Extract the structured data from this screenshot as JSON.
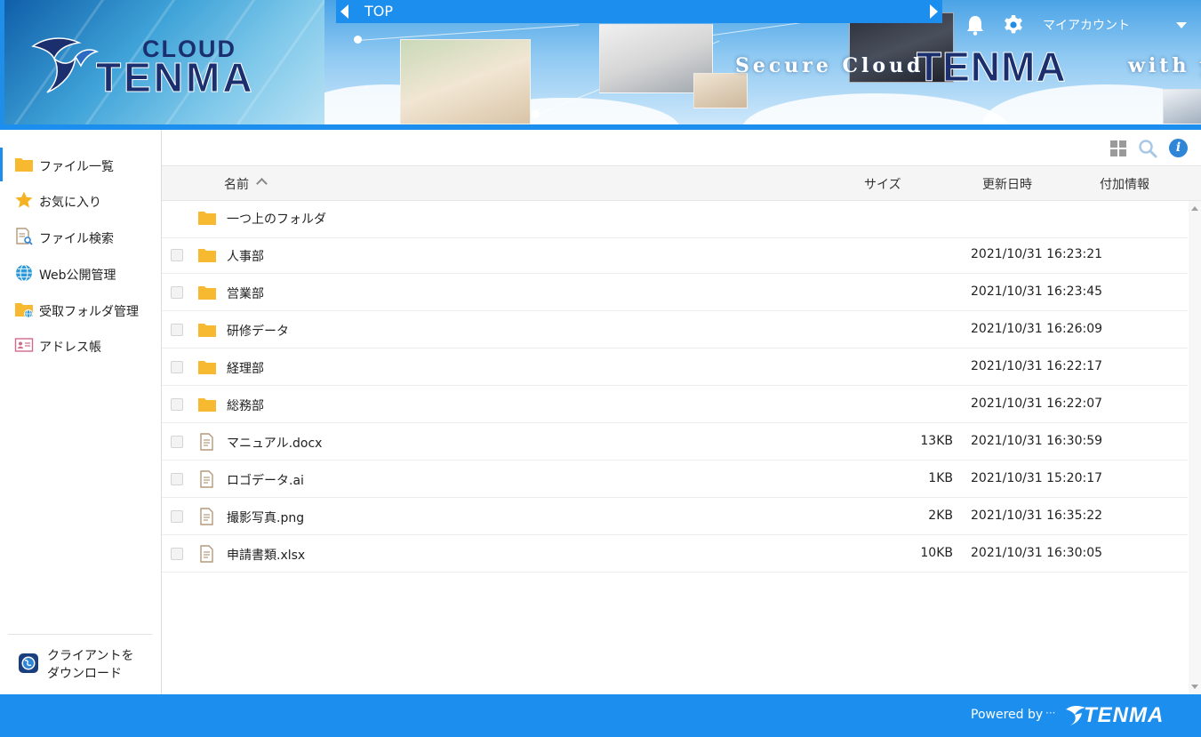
{
  "header": {
    "logo": {
      "cloud_text": "CLOUD",
      "tenma_text": "TENMA"
    },
    "banner": {
      "secure_text": "Secure Cloud",
      "tenma_text": "TENMA",
      "with_text": "with y"
    },
    "breadcrumb": {
      "current": "TOP"
    },
    "account_label": "マイアカウント",
    "icons": {
      "notification": "bell-icon",
      "settings": "gear-icon",
      "account_menu": "chevron-down-icon"
    }
  },
  "sidebar": {
    "items": [
      {
        "label": "ファイル一覧",
        "icon": "folder-icon",
        "active": true
      },
      {
        "label": "お気に入り",
        "icon": "star-icon",
        "active": false
      },
      {
        "label": "ファイル検索",
        "icon": "file-search-icon",
        "active": false
      },
      {
        "label": "Web公開管理",
        "icon": "globe-icon",
        "active": false
      },
      {
        "label": "受取フォルダ管理",
        "icon": "folder-globe-icon",
        "active": false
      },
      {
        "label": "アドレス帳",
        "icon": "address-card-icon",
        "active": false
      }
    ],
    "client_download": {
      "label_line1": "クライアントを",
      "label_line2": "ダウンロード",
      "icon": "globe-badge-icon"
    }
  },
  "toolbar": {
    "icons": [
      "grid-view-icon",
      "search-icon",
      "info-icon"
    ],
    "info_glyph": "i"
  },
  "table": {
    "columns": {
      "name": "名前",
      "size": "サイズ",
      "date": "更新日時",
      "extra": "付加情報"
    },
    "sort": {
      "column": "name",
      "direction": "asc"
    },
    "parent_folder_label": "一つ上のフォルダ",
    "rows": [
      {
        "type": "folder",
        "name": "人事部",
        "size": "",
        "date": "2021/10/31 16:23:21"
      },
      {
        "type": "folder",
        "name": "営業部",
        "size": "",
        "date": "2021/10/31 16:23:45"
      },
      {
        "type": "folder",
        "name": "研修データ",
        "size": "",
        "date": "2021/10/31 16:26:09"
      },
      {
        "type": "folder",
        "name": "経理部",
        "size": "",
        "date": "2021/10/31 16:22:17"
      },
      {
        "type": "folder",
        "name": "総務部",
        "size": "",
        "date": "2021/10/31 16:22:07"
      },
      {
        "type": "file",
        "name": "マニュアル.docx",
        "size": "13KB",
        "date": "2021/10/31 16:30:59"
      },
      {
        "type": "file",
        "name": "ロゴデータ.ai",
        "size": "1KB",
        "date": "2021/10/31 15:20:17"
      },
      {
        "type": "file",
        "name": "撮影写真.png",
        "size": "2KB",
        "date": "2021/10/31 16:35:22"
      },
      {
        "type": "file",
        "name": "申請書類.xlsx",
        "size": "10KB",
        "date": "2021/10/31 16:30:05"
      }
    ]
  },
  "footer": {
    "powered_by": "Powered by",
    "dots": "···",
    "brand": "TENMA"
  },
  "colors": {
    "accent": "#1c8fee",
    "folder": "#f7b92f",
    "file_icon": "#b49a7c",
    "brand_navy": "#1b2f6e"
  }
}
